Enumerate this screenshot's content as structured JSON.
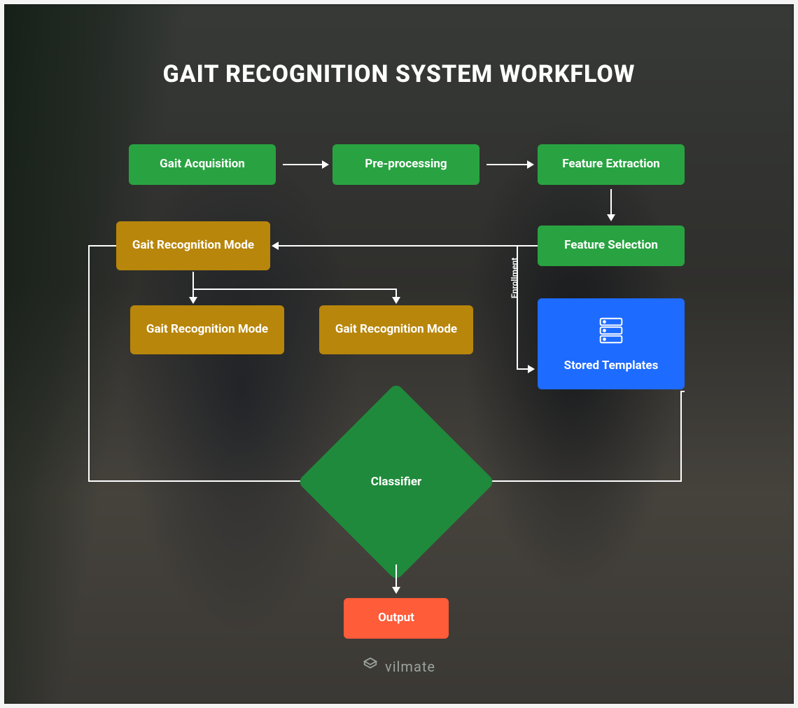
{
  "title": "GAIT RECOGNITION SYSTEM WORKFLOW",
  "nodes": {
    "gait_acquisition": "Gait Acquisition",
    "pre_processing": "Pre-processing",
    "feature_extraction": "Feature Extraction",
    "feature_selection": "Feature Selection",
    "recognition_mode_1": "Gait Recognition Mode",
    "recognition_mode_2": "Gait Recognition Mode",
    "recognition_mode_3": "Gait Recognition Mode",
    "stored_templates": "Stored Templates",
    "classifier": "Classifier",
    "output": "Output"
  },
  "labels": {
    "enrollment": "Enrollment"
  },
  "brand": "vilmate",
  "colors": {
    "green": "#29a341",
    "dark_green": "#1f8a3b",
    "olive": "#b8860b",
    "blue": "#1e6bff",
    "orange": "#ff5c39",
    "arrow": "#ffffff"
  }
}
